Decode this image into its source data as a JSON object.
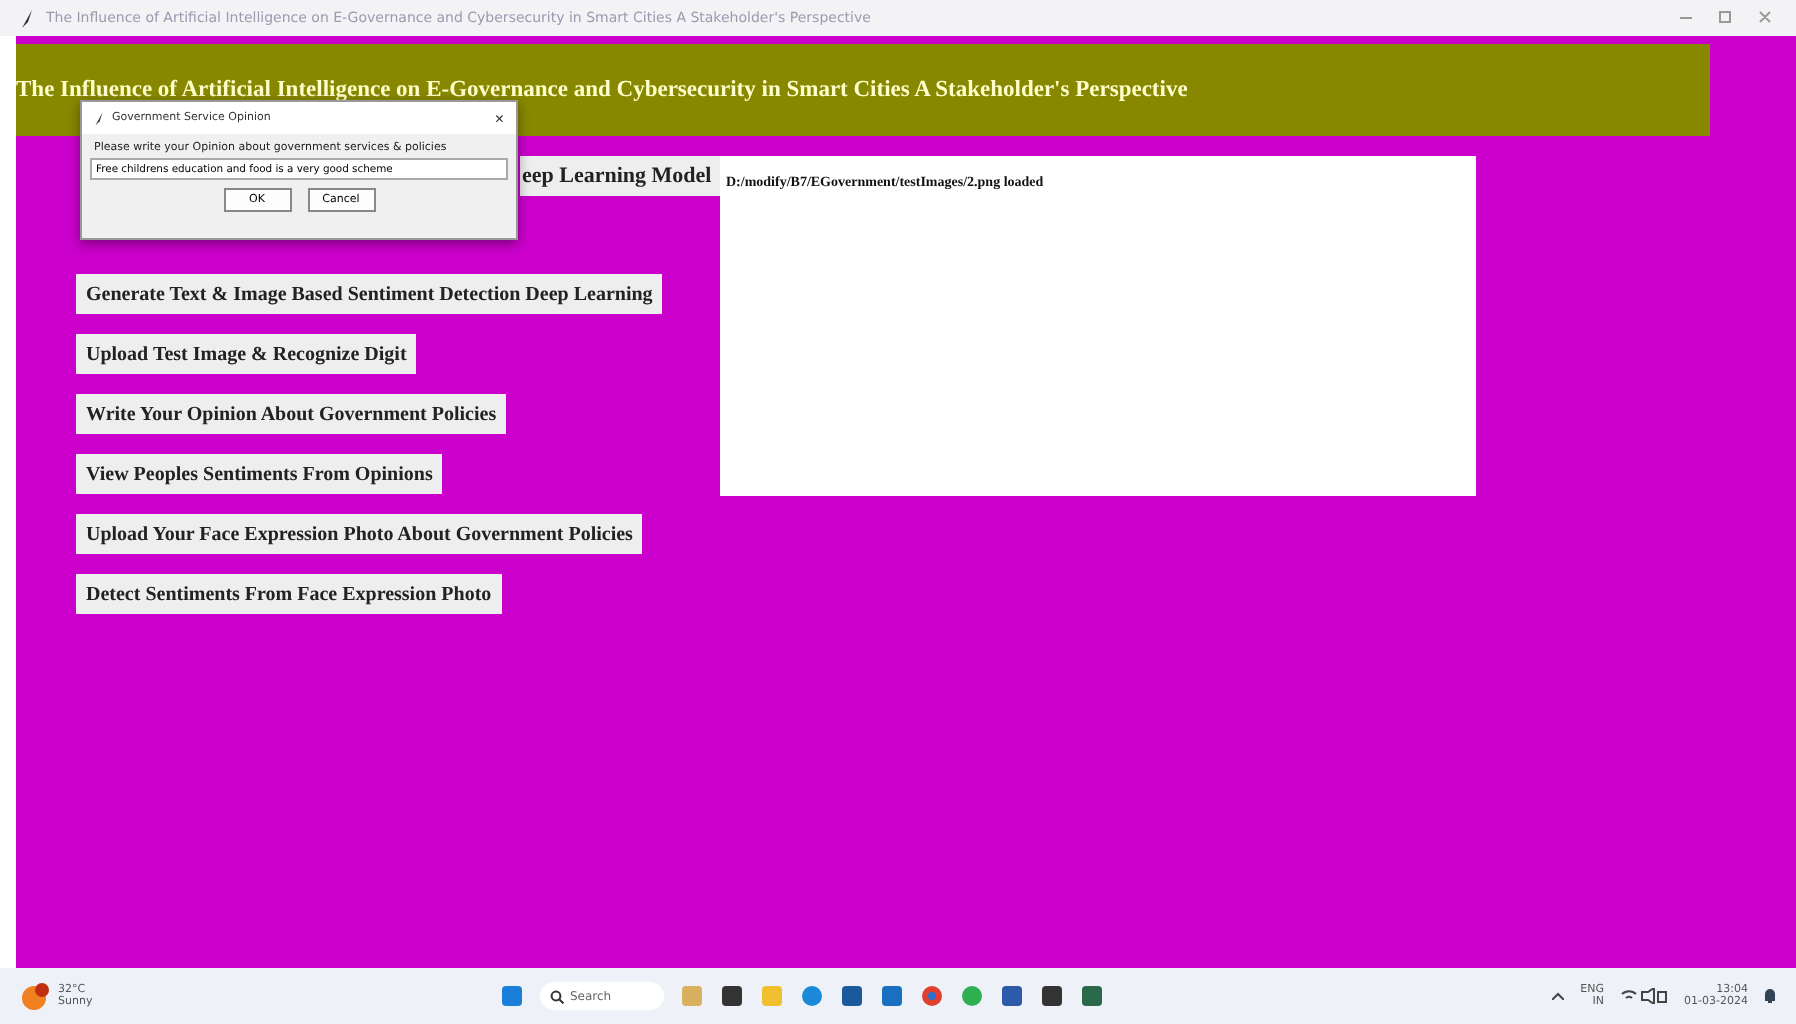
{
  "window": {
    "title": "The Influence of Artificial Intelligence on E-Governance and Cybersecurity in Smart Cities A Stakeholder's Perspective"
  },
  "heading": "The Influence of Artificial Intelligence on E-Governance and Cybersecurity in Smart Cities A Stakeholder's Perspective",
  "buttons": [
    {
      "label": "eep Learning Model",
      "kind": "covered"
    },
    {
      "label": "Generate Text & Image Based Sentiment Detection Deep Learning",
      "kind": "normal"
    },
    {
      "label": "Upload Test Image & Recognize Digit",
      "kind": "normal"
    },
    {
      "label": "Write Your Opinion About Government Policies",
      "kind": "normal"
    },
    {
      "label": "View Peoples Sentiments From Opinions",
      "kind": "normal"
    },
    {
      "label": "Upload Your Face Expression Photo About Government Policies",
      "kind": "normal"
    },
    {
      "label": "Detect Sentiments From Face Expression Photo",
      "kind": "normal"
    }
  ],
  "output": "D:/modify/B7/EGovernment/testImages/2.png loaded",
  "dialog": {
    "title": "Government Service Opinion",
    "close": "×",
    "prompt": "Please write your Opinion about government services & policies",
    "value": "Free childrens education and food is a very good scheme",
    "buttons": [
      "OK",
      "Cancel"
    ]
  },
  "taskbar": {
    "temperature": "32°C",
    "weather": "Sunny",
    "search": {
      "placeholder": "Search"
    },
    "language": "ENG",
    "region": "IN",
    "time": "13:04",
    "date": "01-03-2024"
  }
}
